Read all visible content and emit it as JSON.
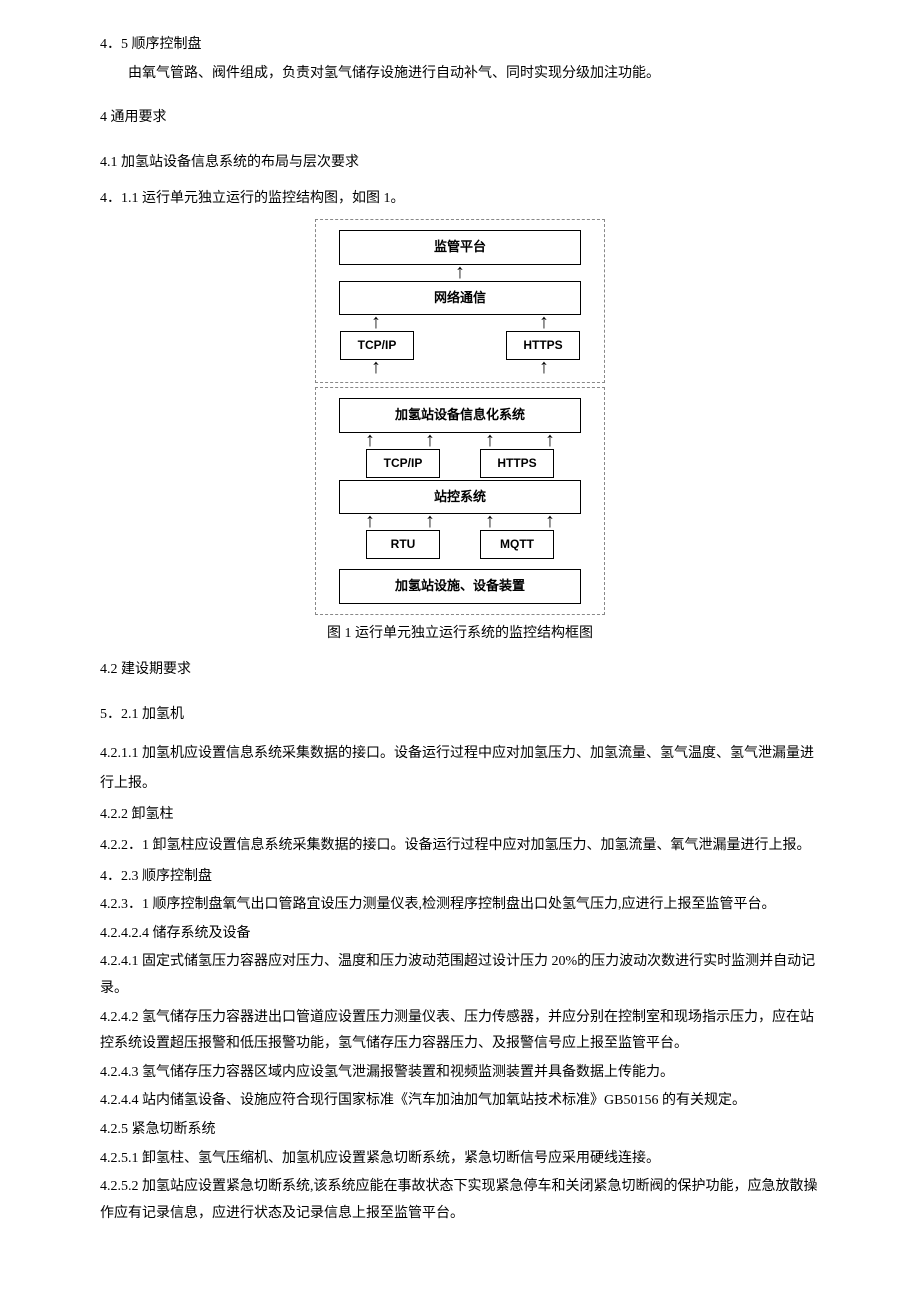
{
  "p1": "4．5 顺序控制盘",
  "p2": "由氧气管路、阀件组成，负责对氢气储存设施进行自动补气、同时实现分级加注功能。",
  "p3": "4 通用要求",
  "p4": "4.1 加氢站设备信息系统的布局与层次要求",
  "p5": "4．1.1 运行单元独立运行的监控结构图，如图 1。",
  "diagram": {
    "n1": "监管平台",
    "n2": "网络通信",
    "n3a": "TCP/IP",
    "n3b": "HTTPS",
    "n4": "加氢站设备信息化系统",
    "n5a": "TCP/IP",
    "n5b": "HTTPS",
    "n6": "站控系统",
    "n7a": "RTU",
    "n7b": "MQTT",
    "n8": "加氢站设施、设备装置"
  },
  "caption": "图 1 运行单元独立运行系统的监控结构框图",
  "p6": "4.2 建设期要求",
  "p7": "5．2.1 加氢机",
  "p8": "4.2.1.1 加氢机应设置信息系统采集数据的接口。设备运行过程中应对加氢压力、加氢流量、氢气温度、氢气泄漏量进行上报。",
  "p9": "4.2.2 卸氢柱",
  "p10": "4.2.2．1 卸氢柱应设置信息系统采集数据的接口。设备运行过程中应对加氢压力、加氢流量、氧气泄漏量进行上报。",
  "p11": "4．2.3 顺序控制盘",
  "p12": "4.2.3．1 顺序控制盘氧气出口管路宜设压力测量仪表,检测程序控制盘出口处氢气压力,应进行上报至监管平台。",
  "p13": "4.2.4.2.4 储存系统及设备",
  "p14": "4.2.4.1 固定式储氢压力容器应对压力、温度和压力波动范围超过设计压力 20%的压力波动次数进行实时监测并自动记录。",
  "p15": "4.2.4.2 氢气储存压力容器进出口管道应设置压力测量仪表、压力传感器，并应分别在控制室和现场指示压力，应在站控系统设置超压报警和低压报警功能，氢气储存压力容器压力、及报警信号应上报至监管平台。",
  "p16": "4.2.4.3 氢气储存压力容器区域内应设氢气泄漏报警装置和视频监测装置并具备数据上传能力。",
  "p17": "4.2.4.4 站内储氢设备、设施应符合现行国家标准《汽车加油加气加氧站技术标准》GB50156 的有关规定。",
  "p18": "4.2.5 紧急切断系统",
  "p19": "4.2.5.1 卸氢柱、氢气压缩机、加氢机应设置紧急切断系统，紧急切断信号应采用硬线连接。",
  "p20": "4.2.5.2 加氢站应设置紧急切断系统,该系统应能在事故状态下实现紧急停车和关闭紧急切断阀的保护功能，应急放散操作应有记录信息，应进行状态及记录信息上报至监管平台。"
}
